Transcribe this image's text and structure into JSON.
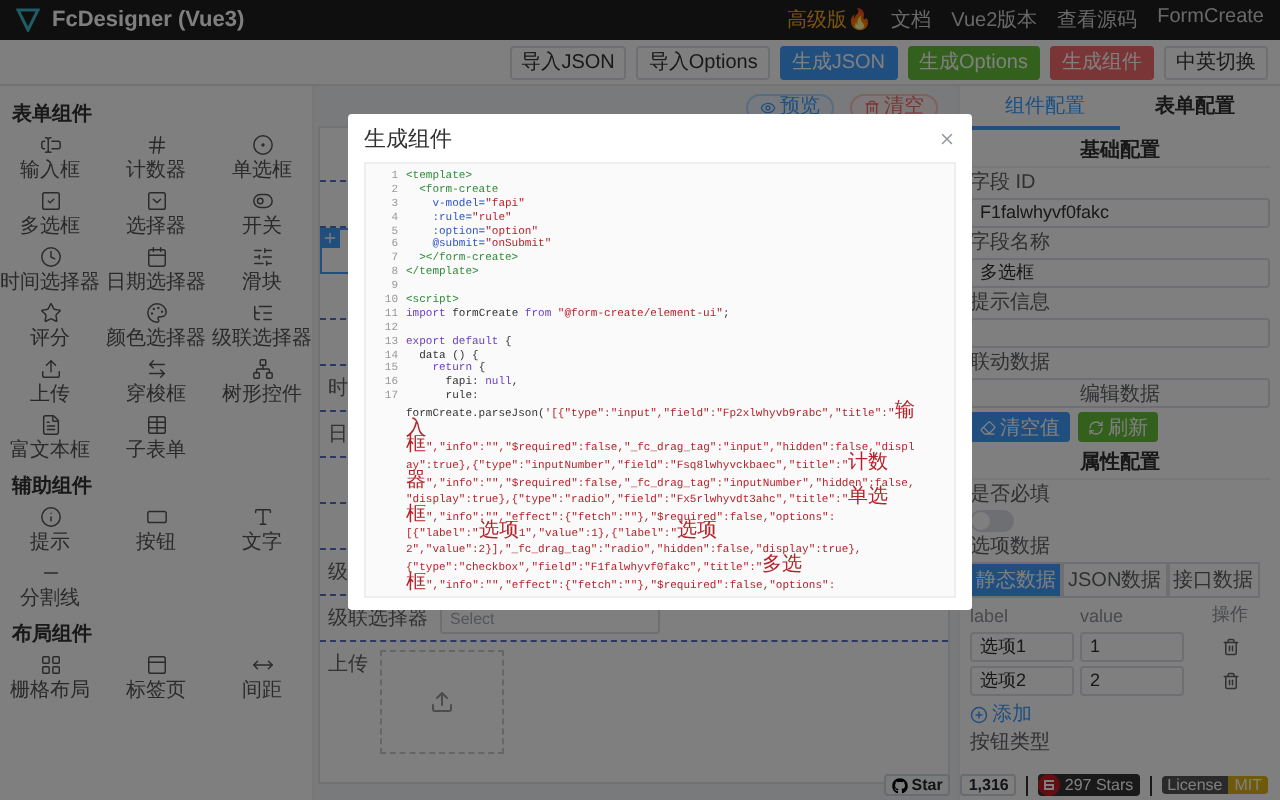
{
  "topbar": {
    "title": "FcDesigner (Vue3)",
    "links": [
      {
        "label": "高级版🔥",
        "kind": "promo"
      },
      {
        "label": "文档",
        "kind": "plain"
      },
      {
        "label": "Vue2版本",
        "kind": "plain"
      },
      {
        "label": "查看源码",
        "kind": "plain"
      },
      {
        "label": "FormCreate",
        "kind": "plain"
      }
    ]
  },
  "toolbar": {
    "buttons": [
      {
        "label": "导入JSON",
        "kind": "default"
      },
      {
        "label": "导入Options",
        "kind": "default"
      },
      {
        "label": "生成JSON",
        "kind": "primary"
      },
      {
        "label": "生成Options",
        "kind": "success"
      },
      {
        "label": "生成组件",
        "kind": "danger"
      },
      {
        "label": "中英切换",
        "kind": "default"
      }
    ]
  },
  "sidebar": {
    "sections": [
      {
        "title": "表单组件",
        "items": [
          {
            "label": "输入框"
          },
          {
            "label": "计数器"
          },
          {
            "label": "单选框"
          },
          {
            "label": "多选框"
          },
          {
            "label": "选择器"
          },
          {
            "label": "开关"
          },
          {
            "label": "时间选择器"
          },
          {
            "label": "日期选择器"
          },
          {
            "label": "滑块"
          },
          {
            "label": "评分"
          },
          {
            "label": "颜色选择器"
          },
          {
            "label": "级联选择器"
          },
          {
            "label": "上传"
          },
          {
            "label": "穿梭框"
          },
          {
            "label": "树形控件"
          },
          {
            "label": "富文本框"
          },
          {
            "label": "子表单"
          }
        ]
      },
      {
        "title": "辅助组件",
        "items": [
          {
            "label": "提示"
          },
          {
            "label": "按钮"
          },
          {
            "label": "文字"
          },
          {
            "label": "分割线"
          }
        ]
      },
      {
        "title": "布局组件",
        "items": [
          {
            "label": "栅格布局"
          },
          {
            "label": "标签页"
          },
          {
            "label": "间距"
          }
        ]
      }
    ]
  },
  "canvas": {
    "actions": [
      {
        "label": "预览",
        "kind": "primary"
      },
      {
        "label": "清空",
        "kind": "danger"
      }
    ],
    "rows": [
      {
        "kind": "field",
        "selected": false
      },
      {
        "kind": "field",
        "selected": false
      },
      {
        "kind": "field",
        "selected": true
      },
      {
        "kind": "field",
        "selected": false
      },
      {
        "kind": "field",
        "selected": false
      },
      {
        "kind": "field",
        "selected": false,
        "label": "时"
      },
      {
        "kind": "field",
        "selected": false,
        "label": "日"
      },
      {
        "kind": "field",
        "selected": false
      },
      {
        "kind": "field",
        "selected": false
      },
      {
        "kind": "field",
        "selected": false,
        "label": "级"
      },
      {
        "kind": "select",
        "selected": false,
        "label": "级联选择器",
        "placeholder": "Select"
      },
      {
        "kind": "upload",
        "selected": false,
        "label": "上传"
      }
    ]
  },
  "config": {
    "tabs": [
      {
        "label": "组件配置",
        "selected": true
      },
      {
        "label": "表单配置",
        "selected": false
      }
    ],
    "basic_title": "基础配置",
    "fields": [
      {
        "label": "字段 ID",
        "value": "F1falwhyvf0fakc"
      },
      {
        "label": "字段名称",
        "value": "多选框"
      },
      {
        "label": "提示信息"
      }
    ],
    "linkage": {
      "label": "联动数据",
      "button": "编辑数据"
    },
    "actions": [
      {
        "label": "清空值",
        "kind": "primary"
      },
      {
        "label": "刷新",
        "kind": "success"
      }
    ],
    "props_title": "属性配置",
    "required": {
      "label": "是否必填",
      "on": false
    },
    "options": {
      "label": "选项数据",
      "tabs": [
        {
          "label": "静态数据",
          "selected": true
        },
        {
          "label": "JSON数据",
          "selected": false
        },
        {
          "label": "接口数据",
          "selected": false
        }
      ],
      "columns": [
        "label",
        "value",
        "操作"
      ],
      "rows": [
        {
          "label": "选项1",
          "value": "1"
        },
        {
          "label": "选项2",
          "value": "2"
        }
      ],
      "add": "添加"
    },
    "button_type_label": "按钮类型"
  },
  "footer": {
    "github": {
      "label": "Star",
      "count": "1,316"
    },
    "gitee": {
      "label": "297 Stars"
    },
    "license": {
      "label": "License",
      "value": "MIT"
    }
  },
  "modal": {
    "title": "生成组件",
    "lines": [
      {
        "num": "1",
        "tokens": [
          {
            "kind": "tag",
            "text": "<template>"
          }
        ]
      },
      {
        "num": "2",
        "tokens": [
          {
            "kind": "tag",
            "text": "  <form-create"
          }
        ]
      },
      {
        "num": "3",
        "tokens": [
          {
            "kind": "attr",
            "text": "    v-model="
          },
          {
            "kind": "str",
            "text": "\"fapi\""
          }
        ]
      },
      {
        "num": "4",
        "tokens": [
          {
            "kind": "attr",
            "text": "    :rule="
          },
          {
            "kind": "str",
            "text": "\"rule\""
          }
        ]
      },
      {
        "num": "5",
        "tokens": [
          {
            "kind": "attr",
            "text": "    :option="
          },
          {
            "kind": "str",
            "text": "\"option\""
          }
        ]
      },
      {
        "num": "6",
        "tokens": [
          {
            "kind": "attr",
            "text": "    @submit="
          },
          {
            "kind": "str",
            "text": "\"onSubmit\""
          }
        ]
      },
      {
        "num": "7",
        "tokens": [
          {
            "kind": "tag",
            "text": "  ></form-create>"
          }
        ]
      },
      {
        "num": "8",
        "tokens": [
          {
            "kind": "tag",
            "text": "</template>"
          }
        ]
      },
      {
        "num": "9"
      },
      {
        "num": "10",
        "tokens": [
          {
            "kind": "tag",
            "text": "<script>"
          }
        ]
      },
      {
        "num": "11",
        "tokens": [
          {
            "kind": "kw",
            "text": "import"
          },
          {
            "kind": "plain",
            "text": " formCreate "
          },
          {
            "kind": "kw",
            "text": "from"
          },
          {
            "kind": "str",
            "text": " \"@form-create/element-ui\""
          },
          {
            "kind": "plain",
            "text": ";"
          }
        ]
      },
      {
        "num": "12"
      },
      {
        "num": "13",
        "tokens": [
          {
            "kind": "kw",
            "text": "export default"
          },
          {
            "kind": "plain",
            "text": " {"
          }
        ]
      },
      {
        "num": "14",
        "tokens": [
          {
            "kind": "plain",
            "text": "  data () {"
          }
        ]
      },
      {
        "num": "15",
        "tokens": [
          {
            "kind": "kw",
            "text": "    return"
          },
          {
            "kind": "plain",
            "text": " {"
          }
        ]
      },
      {
        "num": "16",
        "tokens": [
          {
            "kind": "plain",
            "text": "      fapi: "
          },
          {
            "kind": "kw",
            "text": "null"
          },
          {
            "kind": "plain",
            "text": ","
          }
        ]
      },
      {
        "num": "17",
        "tokens": [
          {
            "kind": "plain",
            "text": "      rule:"
          }
        ]
      },
      {
        "tokens": [
          {
            "kind": "plain",
            "text": "formCreate.parseJson("
          },
          {
            "kind": "str",
            "text": "'[{\"type\":\"input\",\"field\":\"Fp2xlwhyvb9rabc\",\"title\":\"输"
          }
        ]
      },
      {
        "tokens": [
          {
            "kind": "str",
            "text": "入"
          }
        ]
      },
      {
        "tokens": [
          {
            "kind": "str",
            "text": "框\",\"info\":\"\",\"$required\":false,\"_fc_drag_tag\":\"input\",\"hidden\":false,\"displ"
          }
        ]
      },
      {
        "tokens": [
          {
            "kind": "str",
            "text": "ay\":true},{\"type\":\"inputNumber\",\"field\":\"Fsq8lwhyvckbaec\",\"title\":\"计数"
          }
        ]
      },
      {
        "tokens": [
          {
            "kind": "str",
            "text": "器\",\"info\":\"\",\"$required\":false,\"_fc_drag_tag\":\"inputNumber\",\"hidden\":false,"
          }
        ]
      },
      {
        "tokens": [
          {
            "kind": "str",
            "text": "\"display\":true},{\"type\":\"radio\",\"field\":\"Fx5rlwhyvdt3ahc\",\"title\":\"单选"
          }
        ]
      },
      {
        "tokens": [
          {
            "kind": "str",
            "text": "框\",\"info\":\"\",\"effect\":{\"fetch\":\"\"},\"$required\":false,\"options\":"
          }
        ]
      },
      {
        "tokens": [
          {
            "kind": "str",
            "text": "[{\"label\":\"选项1\",\"value\":1},{\"label\":\"选项"
          }
        ]
      },
      {
        "tokens": [
          {
            "kind": "str",
            "text": "2\",\"value\":2}],\"_fc_drag_tag\":\"radio\",\"hidden\":false,\"display\":true},"
          }
        ]
      },
      {
        "tokens": [
          {
            "kind": "str",
            "text": "{\"type\":\"checkbox\",\"field\":\"F1falwhyvf0fakc\",\"title\":\"多选"
          }
        ]
      },
      {
        "tokens": [
          {
            "kind": "str",
            "text": "框\",\"info\":\"\",\"effect\":{\"fetch\":\"\"},\"$required\":false,\"options\":"
          }
        ]
      }
    ]
  }
}
